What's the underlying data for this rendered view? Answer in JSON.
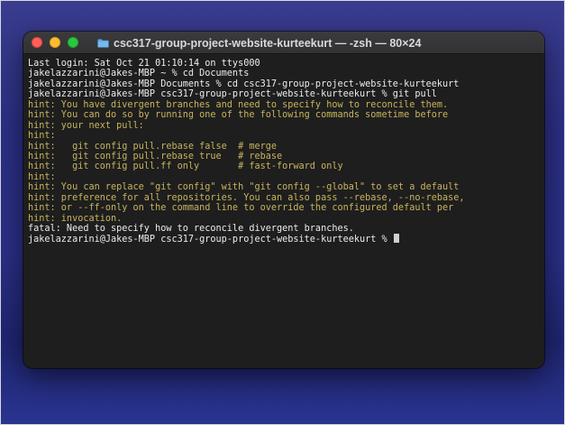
{
  "window": {
    "title": "csc317-group-project-website-kurteekurt — -zsh — 80×24",
    "folder_icon": "folder-icon",
    "buttons": {
      "close": "close-icon",
      "minimize": "minimize-icon",
      "zoom": "zoom-icon"
    }
  },
  "colors": {
    "hint": "#c9b45c",
    "normal": "#ececec",
    "background": "#1e1e1e"
  },
  "terminal": {
    "lines": [
      {
        "type": "normal",
        "text": "Last login: Sat Oct 21 01:10:14 on ttys000"
      },
      {
        "type": "normal",
        "text": "jakelazzarini@Jakes-MBP ~ % cd Documents"
      },
      {
        "type": "normal",
        "text": "jakelazzarini@Jakes-MBP Documents % cd csc317-group-project-website-kurteekurt"
      },
      {
        "type": "normal",
        "text": "jakelazzarini@Jakes-MBP csc317-group-project-website-kurteekurt % git pull"
      },
      {
        "type": "hint",
        "text": "hint: You have divergent branches and need to specify how to reconcile them."
      },
      {
        "type": "hint",
        "text": "hint: You can do so by running one of the following commands sometime before"
      },
      {
        "type": "hint",
        "text": "hint: your next pull:"
      },
      {
        "type": "hint",
        "text": "hint:"
      },
      {
        "type": "hint",
        "text": "hint:   git config pull.rebase false  # merge"
      },
      {
        "type": "hint",
        "text": "hint:   git config pull.rebase true   # rebase"
      },
      {
        "type": "hint",
        "text": "hint:   git config pull.ff only       # fast-forward only"
      },
      {
        "type": "hint",
        "text": "hint:"
      },
      {
        "type": "hint",
        "text": "hint: You can replace \"git config\" with \"git config --global\" to set a default"
      },
      {
        "type": "hint",
        "text": "hint: preference for all repositories. You can also pass --rebase, --no-rebase,"
      },
      {
        "type": "hint",
        "text": "hint: or --ff-only on the command line to override the configured default per"
      },
      {
        "type": "hint",
        "text": "hint: invocation."
      },
      {
        "type": "normal",
        "text": "fatal: Need to specify how to reconcile divergent branches."
      },
      {
        "type": "normal",
        "text": "jakelazzarini@Jakes-MBP csc317-group-project-website-kurteekurt % "
      }
    ]
  }
}
